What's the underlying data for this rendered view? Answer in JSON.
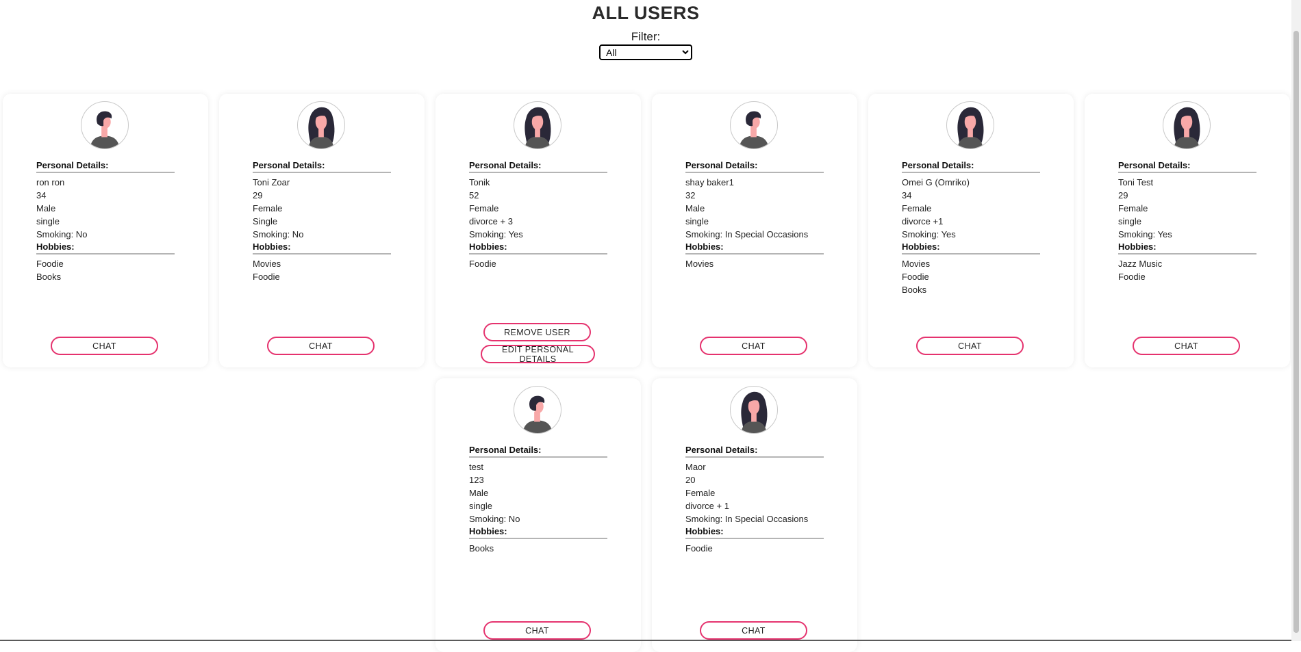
{
  "header": {
    "title": "ALL USERS",
    "filter_label": "Filter:"
  },
  "filter": {
    "options": [
      "All"
    ],
    "selected": "All"
  },
  "labels": {
    "personal_details": "Personal Details:",
    "hobbies": "Hobbies:",
    "chat": "CHAT",
    "remove_user": "REMOVE USER",
    "edit_personal_details": "EDIT PERSONAL DETAILS"
  },
  "users": [
    {
      "avatar": "male-avatar-icon",
      "name": "ron ron",
      "age": "34",
      "gender": "Male",
      "status": "single",
      "smoking": "Smoking: No",
      "hobbies": [
        "Foodie",
        "Books"
      ],
      "own": false
    },
    {
      "avatar": "female-avatar-icon",
      "name": "Toni Zoar",
      "age": "29",
      "gender": "Female",
      "status": "Single",
      "smoking": "Smoking: No",
      "hobbies": [
        "Movies",
        "Foodie"
      ],
      "own": false
    },
    {
      "avatar": "female-avatar-icon",
      "name": "Tonik",
      "age": "52",
      "gender": "Female",
      "status": "divorce + 3",
      "smoking": "Smoking: Yes",
      "hobbies": [
        "Foodie"
      ],
      "own": true
    },
    {
      "avatar": "male-avatar-icon",
      "name": "shay baker1",
      "age": "32",
      "gender": "Male",
      "status": "single",
      "smoking": "Smoking: In Special Occasions",
      "hobbies": [
        "Movies"
      ],
      "own": false
    },
    {
      "avatar": "female-avatar-icon",
      "name": "Omei G (Omriko)",
      "age": "34",
      "gender": "Female",
      "status": "divorce +1",
      "smoking": "Smoking: Yes",
      "hobbies": [
        "Movies",
        "Foodie",
        "Books"
      ],
      "own": false
    },
    {
      "avatar": "female-avatar-icon",
      "name": "Toni Test",
      "age": "29",
      "gender": "Female",
      "status": "single",
      "smoking": "Smoking: Yes",
      "hobbies": [
        "Jazz Music",
        "Foodie"
      ],
      "own": false
    },
    {
      "avatar": "male-avatar-icon",
      "name": "test",
      "age": "123",
      "gender": "Male",
      "status": "single",
      "smoking": "Smoking: No",
      "hobbies": [
        "Books"
      ],
      "own": false
    },
    {
      "avatar": "female-avatar-icon",
      "name": "Maor",
      "age": "20",
      "gender": "Female",
      "status": "divorce + 1",
      "smoking": "Smoking: In Special Occasions",
      "hobbies": [
        "Foodie"
      ],
      "own": false
    }
  ],
  "colors": {
    "accent": "#e5326e",
    "divider": "#b5b5b5",
    "avatar_hair": "#2a2838",
    "avatar_skin": "#f8a8a8",
    "avatar_shirt": "#555555"
  }
}
